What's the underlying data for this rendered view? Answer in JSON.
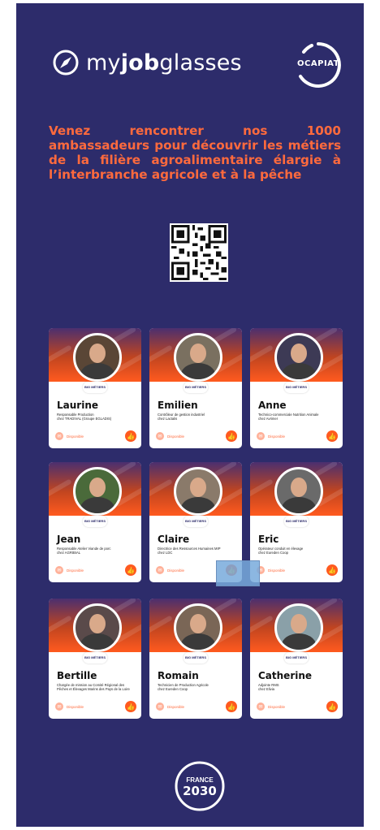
{
  "brand": {
    "myjobglasses_prefix": "my",
    "myjobglasses_bold": "job",
    "myjobglasses_suffix": "glasses",
    "ocapiat": "OCAPIAT"
  },
  "headline": "Venez rencontrer nos 1000 ambassadeurs pour découvrir les métiers de la filière agroalimentaire élargie à l’interbranche agricole et à la pêche",
  "qr_label": "QR code",
  "card_badge": "BIG MÉTIERS",
  "dispo_label": "Disponible",
  "cards": [
    {
      "name": "Laurine",
      "role": "Responsable Production\nchez TRADIVAL (Groupe EGLADIS)"
    },
    {
      "name": "Emilien",
      "role": "Contrôleur de gestion industriel\nchez Lactalis"
    },
    {
      "name": "Anne",
      "role": "Technico-commerciale Nutrition Animale\nchez Avrimer"
    },
    {
      "name": "Jean",
      "role": "Responsable Atelier Viande de porc\nchez AGRIBIAL"
    },
    {
      "name": "Claire",
      "role": "Directrice des Ressources Humaines MIP\nchez LDC"
    },
    {
      "name": "Eric",
      "role": "Opérateur conduit en élevage\nchez Eureden Coop"
    },
    {
      "name": "Bertille",
      "role": "Chargée de mission au Comité Régional des\nPêches et Élevages Marins des Pays de la Loire"
    },
    {
      "name": "Romain",
      "role": "Technicien de Production Agricole\nchez Eureden Coop"
    },
    {
      "name": "Catherine",
      "role": "Adjointe RMS\nchez Elivia"
    }
  ],
  "france2030": {
    "line1": "FRANCE",
    "line2": "2030"
  },
  "colors": {
    "background": "#2d2c6b",
    "accent": "#ff6a3d",
    "card": "#ffffff"
  }
}
